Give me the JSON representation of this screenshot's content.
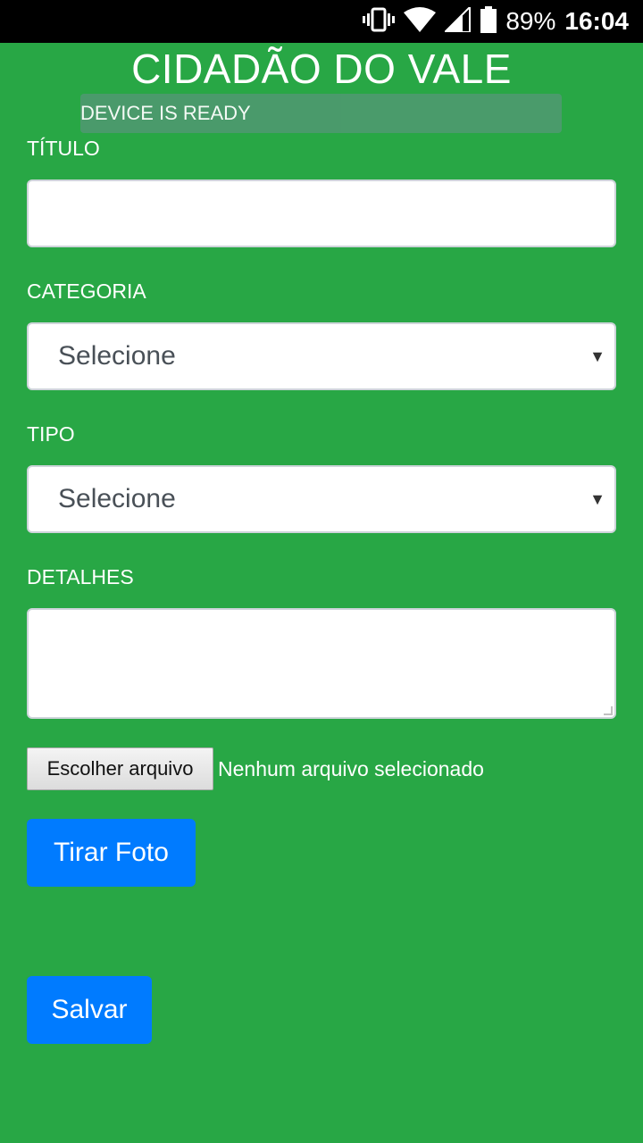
{
  "status_bar": {
    "battery_percent": "89%",
    "time": "16:04",
    "icons": [
      "vibrate-icon",
      "wifi-icon",
      "cell-signal-icon",
      "battery-icon"
    ]
  },
  "app": {
    "title": "CIDADÃO DO VALE",
    "device_status": "DEVICE IS READY"
  },
  "form": {
    "titulo": {
      "label": "TÍTULO",
      "value": ""
    },
    "categoria": {
      "label": "CATEGORIA",
      "selected": "Selecione"
    },
    "tipo": {
      "label": "TIPO",
      "selected": "Selecione"
    },
    "detalhes": {
      "label": "DETALHES",
      "value": ""
    },
    "file": {
      "button_label": "Escolher arquivo",
      "status": "Nenhum arquivo selecionado"
    },
    "photo_button": "Tirar Foto",
    "save_button": "Salvar"
  },
  "colors": {
    "background": "#28a745",
    "primary_button": "#007bff",
    "banner": "#4c9a6e"
  }
}
